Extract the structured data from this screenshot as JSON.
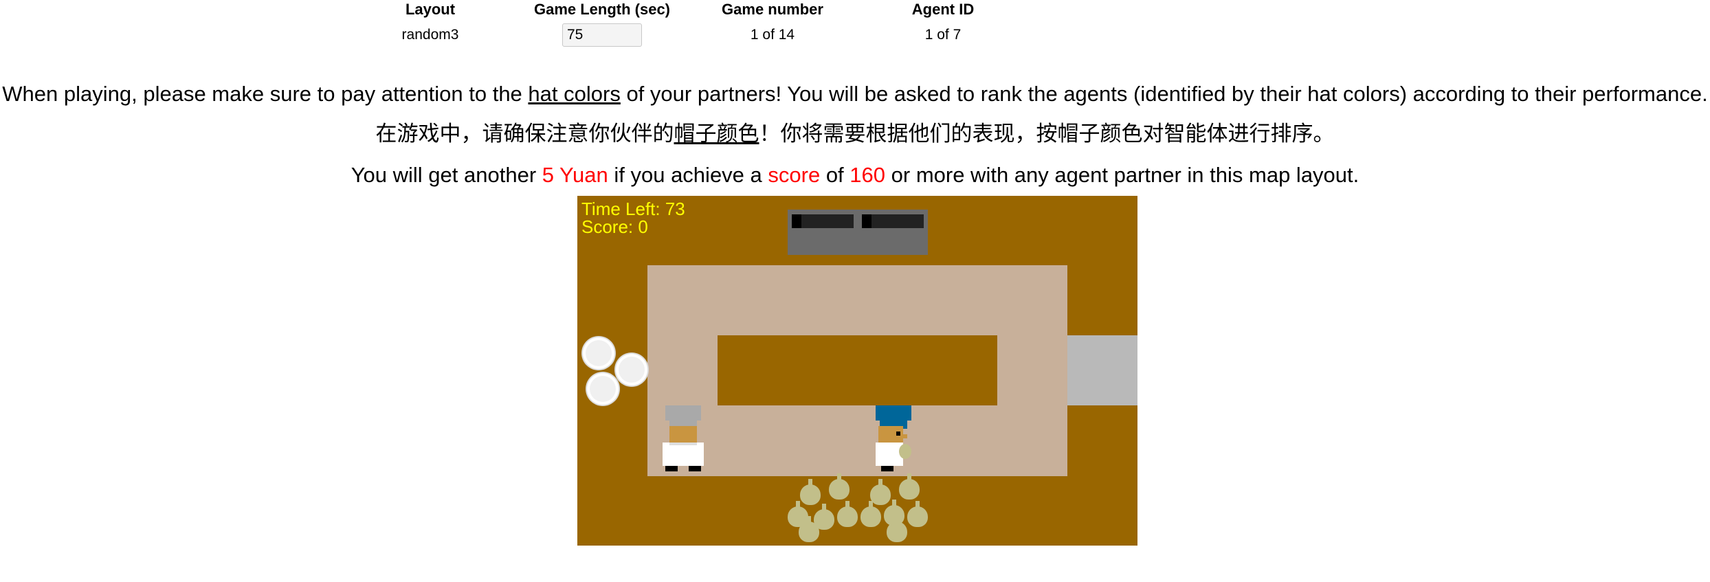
{
  "header": {
    "layout_label": "Layout",
    "layout_value": "random3",
    "length_label": "Game Length (sec)",
    "length_value": "75",
    "game_number_label": "Game number",
    "game_number_value": "1 of 14",
    "agent_id_label": "Agent ID",
    "agent_id_value": "1 of 7"
  },
  "instructions": {
    "line1_pre": "When playing, please make sure to pay attention to the ",
    "line1_link": "hat colors",
    "line1_post": " of your partners! You will be asked to rank the agents (identified by their hat colors) according to their performance.",
    "line2_pre": "在游戏中，请确保注意你伙伴的",
    "line2_link": "帽子颜色",
    "line2_post": "！你将需要根据他们的表现，按帽子颜色对智能体进行排序。",
    "line3_a": "You will get another ",
    "line3_reward": "5 Yuan",
    "line3_b": " if you achieve a ",
    "line3_score_word": "score",
    "line3_c": " of ",
    "line3_target": "160",
    "line3_d": " or more with any agent partner in this map layout."
  },
  "game": {
    "time_left_label": "Time Left: 73",
    "score_label": "Score: 0",
    "chefs": [
      {
        "name": "partner-chef",
        "hat_color": "#a9a9a9",
        "facing": "down",
        "holding": "none"
      },
      {
        "name": "player-chef",
        "hat_color": "#006699",
        "facing": "right",
        "holding": "onion"
      }
    ],
    "colors": {
      "counter": "#996600",
      "floor": "#c8b09a",
      "pot_station": "#6b6b6b",
      "serving": "#b9b9b9",
      "hud_text": "#ffff00",
      "highlight_text": "#ff0000"
    }
  }
}
